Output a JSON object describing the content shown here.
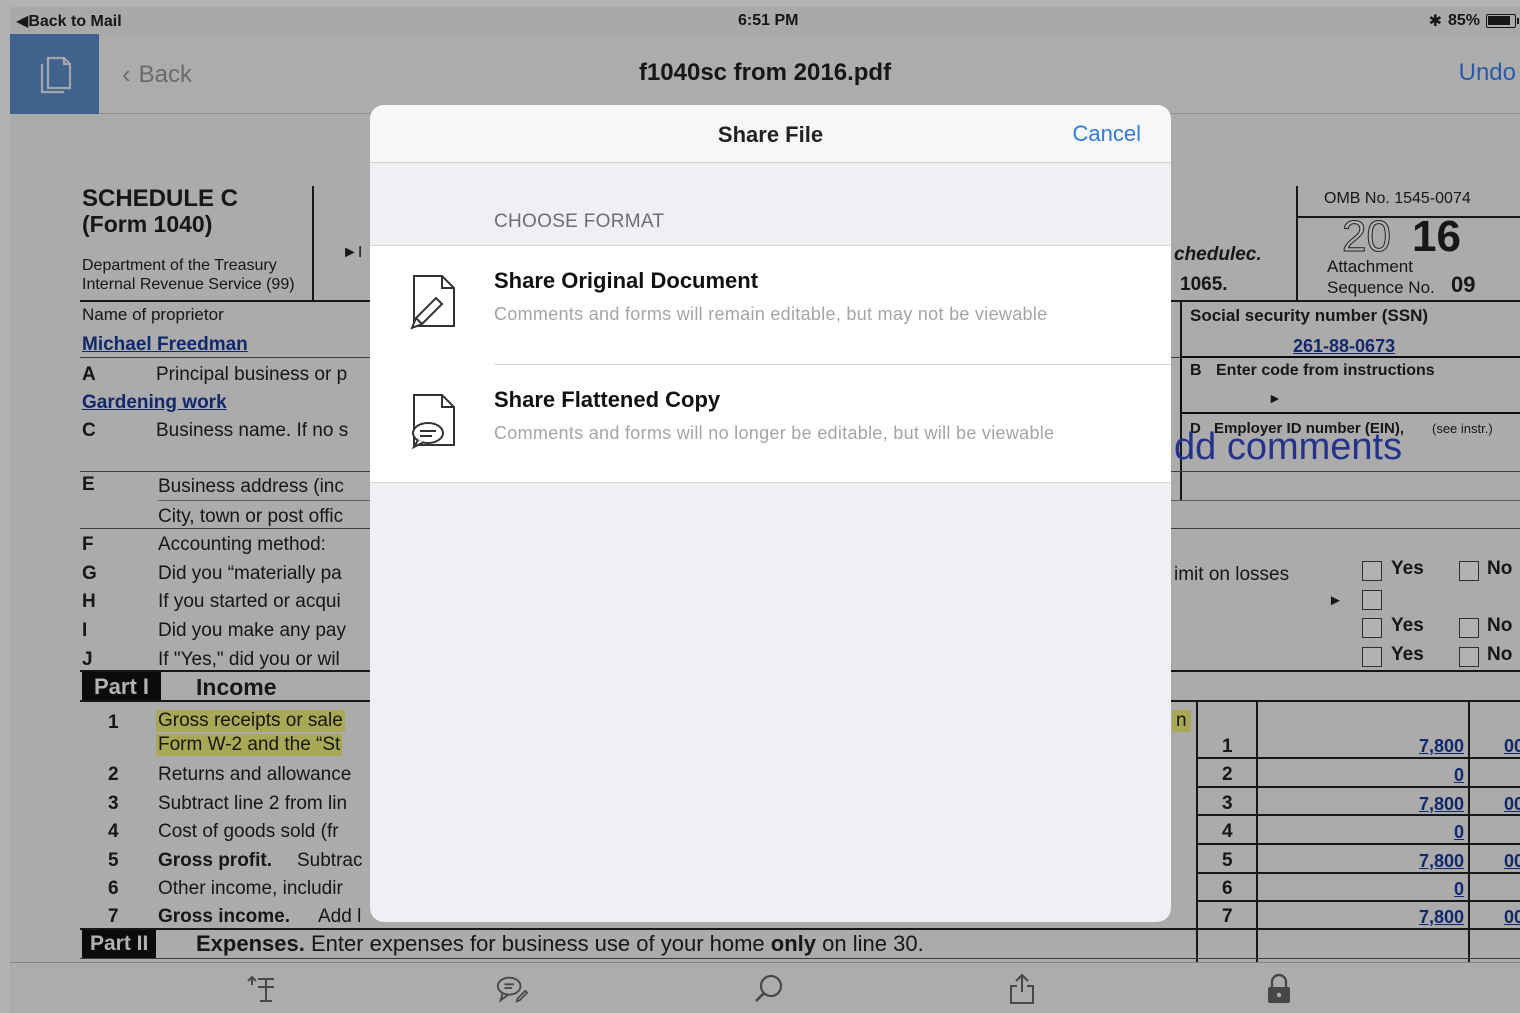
{
  "status_bar": {
    "back_to_app": "Back to Mail",
    "time": "6:51 PM",
    "battery": "85%"
  },
  "nav": {
    "back_label": "Back",
    "title": "f1040sc from 2016.pdf",
    "undo_label": "Undo"
  },
  "form": {
    "schedule": "SCHEDULE C",
    "form_no": "(Form 1040)",
    "dept1": "Department of the Treasury",
    "dept2": "Internal Revenue Service (99)",
    "omb": "OMB No. 1545-0074",
    "year_prefix": "20",
    "year_suffix": "16",
    "attachment": "Attachment",
    "sequence": "Sequence No.",
    "sequence_no": "09",
    "schedulec": "chedulec.",
    "f1065": "1065.",
    "name_label": "Name of proprietor",
    "name_value": "Michael Freedman",
    "ssn_label": "Social security number (SSN)",
    "ssn_value": "261-88-0673",
    "a_letter": "A",
    "a_text": "Principal business or p",
    "a_value": "Gardening work",
    "b_label": "Enter code from instructions",
    "b_letter": "B",
    "c_letter": "C",
    "c_text": "Business name. If no s",
    "d_letter": "D",
    "d_label": "Employer ID number (EIN),",
    "d_note": "(see instr.)",
    "comments_overlay": "dd comments",
    "e_letter": "E",
    "e_text": "Business address (inc",
    "e_text2": "City, town or post offic",
    "f_letter": "F",
    "f_text": "Accounting method:",
    "g_letter": "G",
    "g_text": "Did you “materially pa",
    "g_right": "imit on losses",
    "h_letter": "H",
    "h_text": "If you started or acqui",
    "i_letter": "I",
    "i_text": "Did you make any pay",
    "j_letter": "J",
    "j_text": "If \"Yes,\" did you or wil",
    "yes": "Yes",
    "no": "No",
    "part1_label": "Part I",
    "part1_title": "Income",
    "line1a": "Gross receipts or sale",
    "line1b": "Form W-2 and the “St",
    "line1_tail": "n",
    "lines": [
      {
        "num": "1",
        "text": "",
        "box": "1",
        "amount": "7,800",
        "cents": "00"
      },
      {
        "num": "2",
        "text": "Returns and allowance",
        "box": "2",
        "amount": "0",
        "cents": ""
      },
      {
        "num": "3",
        "text": "Subtract line 2 from lin",
        "box": "3",
        "amount": "7,800",
        "cents": "00"
      },
      {
        "num": "4",
        "text": "Cost of goods sold (fr",
        "box": "4",
        "amount": "0",
        "cents": ""
      },
      {
        "num": "5",
        "text": "Subtrac",
        "bold_text": "Gross profit.",
        "box": "5",
        "amount": "7,800",
        "cents": "00"
      },
      {
        "num": "6",
        "text": "Other income, includir",
        "box": "6",
        "amount": "0",
        "cents": ""
      },
      {
        "num": "7",
        "text": "Add l",
        "bold_text": "Gross income.",
        "box": "7",
        "amount": "7,800",
        "cents": "00"
      }
    ],
    "part2_label": "Part II",
    "part2_bold": "Expenses.",
    "part2_text": "Enter expenses for business use of your home",
    "part2_only": "only",
    "part2_tail": "on line 30."
  },
  "modal": {
    "title": "Share File",
    "cancel_label": "Cancel",
    "section_label": "CHOOSE FORMAT",
    "options": [
      {
        "title": "Share Original Document",
        "subtitle": "Comments and forms will remain editable, but may not be viewable",
        "icon": "document-pencil-icon"
      },
      {
        "title": "Share Flattened Copy",
        "subtitle": "Comments and forms will no longer be editable, but will be viewable",
        "icon": "document-comment-icon"
      }
    ]
  },
  "toolbar": {
    "icons": [
      "text-select-icon",
      "comment-icon",
      "search-icon",
      "share-icon",
      "lock-icon"
    ]
  }
}
